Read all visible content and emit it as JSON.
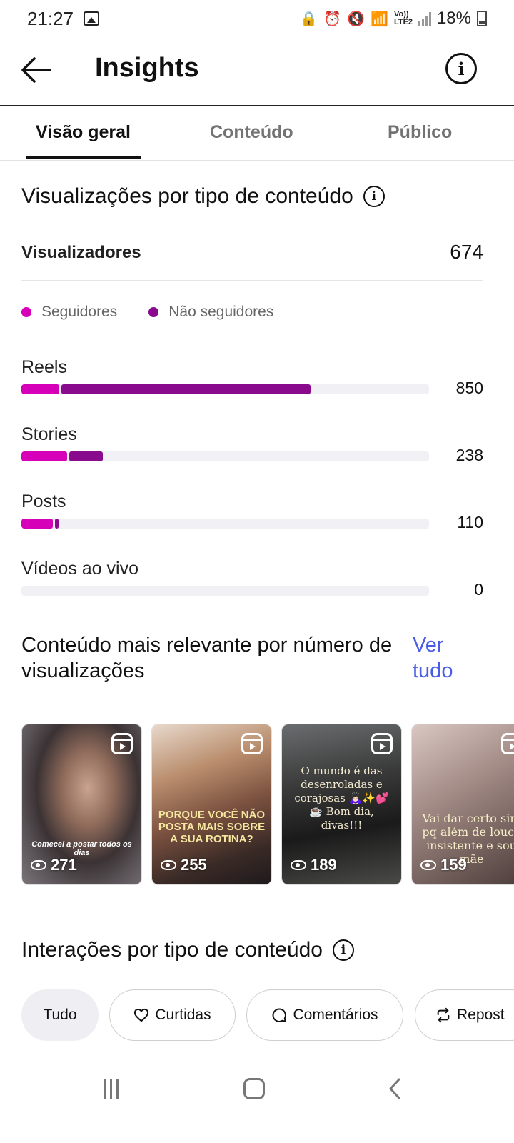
{
  "status_bar": {
    "time": "21:27",
    "battery": "18%",
    "network": "Vo)) LTE2"
  },
  "header": {
    "title": "Insights"
  },
  "tabs": [
    {
      "label": "Visão geral",
      "active": true
    },
    {
      "label": "Conteúdo",
      "active": false
    },
    {
      "label": "Público",
      "active": false
    }
  ],
  "views_section": {
    "title": "Visualizações por tipo de conteúdo",
    "viewers_label": "Visualizadores",
    "viewers_value": "674",
    "legend": [
      {
        "label": "Seguidores",
        "color": "#d600b9"
      },
      {
        "label": "Não seguidores",
        "color": "#8a0a8e"
      }
    ],
    "max_value": 850,
    "rows": [
      {
        "label": "Reels",
        "value": "850",
        "followers_share": 0.131,
        "non_followers_share": 0.869
      },
      {
        "label": "Stories",
        "value": "238",
        "followers_share": 0.56,
        "non_followers_share": 0.44
      },
      {
        "label": "Posts",
        "value": "110",
        "followers_share": 0.83,
        "non_followers_share": 0.17
      },
      {
        "label": "Vídeos ao vivo",
        "value": "0",
        "followers_share": 0,
        "non_followers_share": 0
      }
    ]
  },
  "relevant_section": {
    "title": "Conteúdo mais relevante por número de visualizações",
    "see_all": "Ver tudo",
    "items": [
      {
        "views": "271",
        "caption": "Comecei a postar todos os dias",
        "icon": "reel-icon"
      },
      {
        "views": "255",
        "caption": "PORQUE VOCÊ NÃO POSTA MAIS SOBRE A SUA ROTINA?",
        "icon": "reel-icon"
      },
      {
        "views": "189",
        "caption": "O mundo é das desenroladas e corajosas 🙇🏻‍♀️✨💕☕ Bom dia, divas!!!",
        "icon": "reel-icon"
      },
      {
        "views": "159",
        "caption": "Vai dar certo sim pq além de louca insistente e sou mãe",
        "icon": "reel-icon"
      }
    ]
  },
  "interactions_section": {
    "title": "Interações por tipo de conteúdo",
    "chips": [
      {
        "label": "Tudo",
        "icon": "",
        "active": true
      },
      {
        "label": "Curtidas",
        "icon": "heart-icon",
        "active": false
      },
      {
        "label": "Comentários",
        "icon": "comment-icon",
        "active": false
      },
      {
        "label": "Repost",
        "icon": "repost-icon",
        "active": false
      }
    ]
  }
}
